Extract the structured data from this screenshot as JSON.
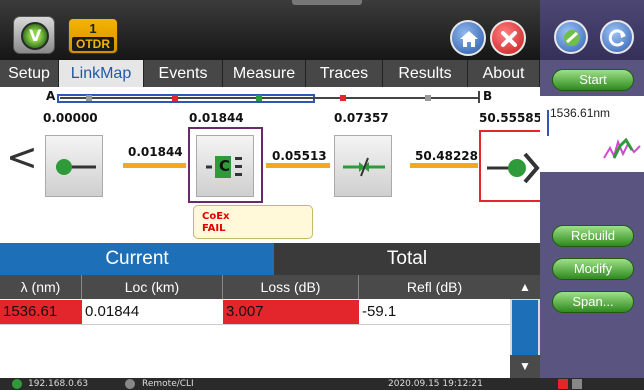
{
  "app": {
    "badge_number": "1",
    "badge_label": "OTDR",
    "logo_glyph": "V"
  },
  "tabs": [
    "Setup",
    "LinkMap",
    "Events",
    "Measure",
    "Traces",
    "Results",
    "About"
  ],
  "active_tab": "LinkMap",
  "side_buttons": {
    "start": "Start",
    "rebuild": "Rebuild",
    "modify": "Modify",
    "span": "Span..."
  },
  "mini_trace": {
    "wavelength": "1536.61nm"
  },
  "linkmap": {
    "marker_a": "A",
    "marker_b": "B",
    "positions": [
      "0.00000",
      "0.01844",
      "0.07357",
      "50.55585"
    ],
    "segments": [
      "0.01844",
      "0.05513",
      "50.48228"
    ],
    "callout": {
      "line1": "CoEx",
      "line2": "FAIL"
    },
    "event_c_letter": "C"
  },
  "result_tabs": {
    "current": "Current",
    "total": "Total"
  },
  "table": {
    "headers": [
      "λ (nm)",
      "Loc (km)",
      "Loss (dB)",
      "Refl (dB)"
    ],
    "rows": [
      {
        "wavelength": "1536.61",
        "loc": "0.01844",
        "loss": "3.007",
        "refl": "-59.1"
      }
    ]
  },
  "status": {
    "ip": "192.168.0.63",
    "remote": "Remote/CLI",
    "datetime": "2020.09.15 19:12:21"
  },
  "colors": {
    "accent_blue": "#1d70b8",
    "fail_red": "#e3262b",
    "fiber_orange": "#f5a623",
    "button_green": "#3d9a28",
    "panel_purple": "#5a5480",
    "badge_yellow": "#f3b400"
  }
}
